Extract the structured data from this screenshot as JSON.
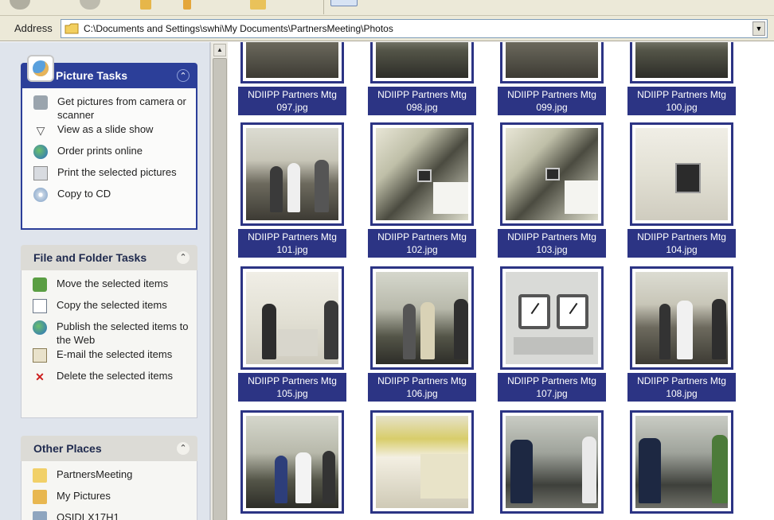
{
  "address": {
    "label": "Address",
    "path": "C:\\Documents and Settings\\swhi\\My Documents\\PartnersMeeting\\Photos"
  },
  "picture_tasks": {
    "title": "Picture Tasks",
    "items": [
      {
        "label": "Get pictures from camera or scanner",
        "icon": "camera-icon"
      },
      {
        "label": "View as a slide show",
        "icon": "slideshow-icon"
      },
      {
        "label": "Order prints online",
        "icon": "globe-icon"
      },
      {
        "label": "Print the selected pictures",
        "icon": "printer-icon"
      },
      {
        "label": "Copy to CD",
        "icon": "cd-icon"
      }
    ]
  },
  "file_tasks": {
    "title": "File and Folder Tasks",
    "items": [
      {
        "label": "Move the selected items",
        "icon": "move-icon"
      },
      {
        "label": "Copy the selected items",
        "icon": "copy-icon"
      },
      {
        "label": "Publish the selected items to the Web",
        "icon": "globe-icon"
      },
      {
        "label": "E-mail the selected items",
        "icon": "email-icon"
      },
      {
        "label": "Delete the selected items",
        "icon": "delete-icon"
      }
    ]
  },
  "other_places": {
    "title": "Other Places",
    "items": [
      {
        "label": "PartnersMeeting",
        "icon": "folder-icon"
      },
      {
        "label": "My Pictures",
        "icon": "my-pictures-icon"
      },
      {
        "label": "OSIDLX17H1",
        "icon": "computer-icon"
      }
    ]
  },
  "thumbnails": [
    {
      "caption_line1": "NDIIPP Partners Mtg",
      "caption_line2": "097.jpg"
    },
    {
      "caption_line1": "NDIIPP Partners Mtg",
      "caption_line2": "098.jpg"
    },
    {
      "caption_line1": "NDIIPP Partners Mtg",
      "caption_line2": "099.jpg"
    },
    {
      "caption_line1": "NDIIPP Partners Mtg",
      "caption_line2": "100.jpg"
    },
    {
      "caption_line1": "NDIIPP Partners Mtg",
      "caption_line2": "101.jpg"
    },
    {
      "caption_line1": "NDIIPP Partners Mtg",
      "caption_line2": "102.jpg"
    },
    {
      "caption_line1": "NDIIPP Partners Mtg",
      "caption_line2": "103.jpg"
    },
    {
      "caption_line1": "NDIIPP Partners Mtg",
      "caption_line2": "104.jpg"
    },
    {
      "caption_line1": "NDIIPP Partners Mtg",
      "caption_line2": "105.jpg"
    },
    {
      "caption_line1": "NDIIPP Partners Mtg",
      "caption_line2": "106.jpg"
    },
    {
      "caption_line1": "NDIIPP Partners Mtg",
      "caption_line2": "107.jpg"
    },
    {
      "caption_line1": "NDIIPP Partners Mtg",
      "caption_line2": "108.jpg"
    }
  ],
  "colors": {
    "selection": "#2c3484",
    "picture_tasks_header": "#2c3f99",
    "task_pane_bg": "#dfe4ec"
  }
}
